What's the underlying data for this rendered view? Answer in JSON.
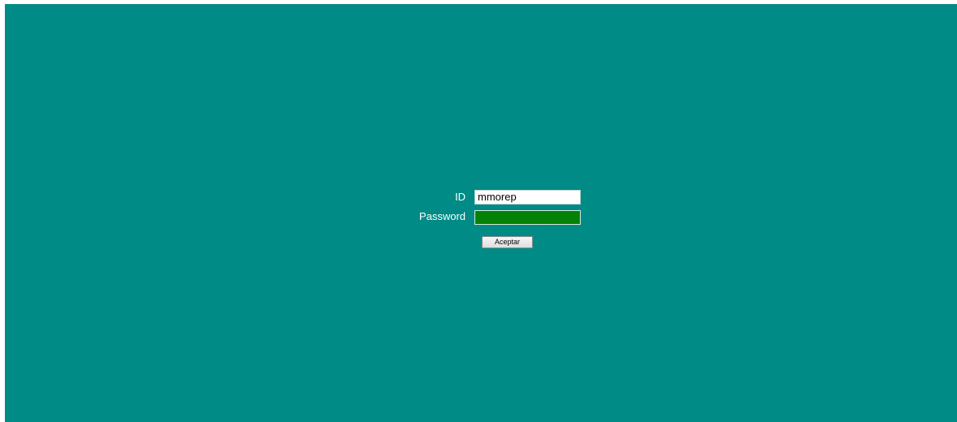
{
  "colors": {
    "background": "#008b87",
    "password_field_fill": "#048106",
    "label_text": "#ffffff"
  },
  "login": {
    "id_label": "ID",
    "id_value": "mmorep",
    "password_label": "Password",
    "password_value": "",
    "accept_label": "Aceptar"
  }
}
